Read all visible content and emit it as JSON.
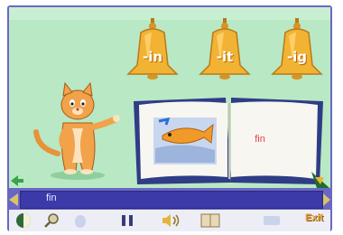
{
  "bells": [
    {
      "label": "-in"
    },
    {
      "label": "-it"
    },
    {
      "label": "-ig"
    }
  ],
  "book": {
    "word": "fin",
    "picture": "fish-picture"
  },
  "text_bar": {
    "text": "fin"
  },
  "toolbar": {
    "items": [
      "globe-icon",
      "magnifier-icon",
      "mouse-icon",
      "pause-icon",
      "sound-icon",
      "book-icon",
      "options-icon"
    ],
    "exit_label": "Exit"
  },
  "colors": {
    "background": "#b9e8c4",
    "frame": "#6a67c4",
    "bell": "#f2b233",
    "text_bar": "#3b3aa8",
    "book_word": "#e0404a"
  }
}
